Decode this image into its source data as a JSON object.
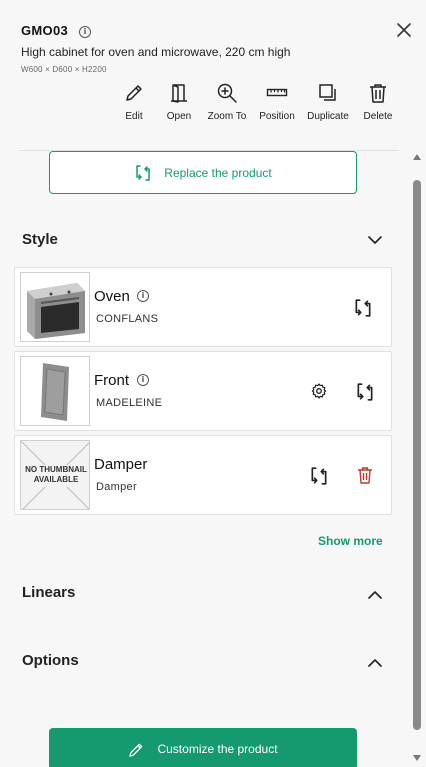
{
  "header": {
    "title": "GMO03",
    "subtitle": "High cabinet for oven and microwave, 220 cm high",
    "dimensions": "W600 × D600 × H2200"
  },
  "toolbar": {
    "items": [
      {
        "label": "Edit",
        "icon": "pencil-icon"
      },
      {
        "label": "Open",
        "icon": "door-open-icon"
      },
      {
        "label": "Zoom To",
        "icon": "zoom-in-icon"
      },
      {
        "label": "Position",
        "icon": "ruler-icon"
      },
      {
        "label": "Duplicate",
        "icon": "duplicate-icon"
      },
      {
        "label": "Delete",
        "icon": "trash-icon"
      }
    ]
  },
  "replace_button": {
    "label": "Replace the product",
    "icon": "replace-icon"
  },
  "sections": {
    "style": {
      "title": "Style",
      "expanded": true
    },
    "linears": {
      "title": "Linears",
      "expanded": false
    },
    "options": {
      "title": "Options",
      "expanded": false
    }
  },
  "style_items": [
    {
      "name": "Oven",
      "variant": "CONFLANS",
      "thumbnail": "oven-image"
    },
    {
      "name": "Front",
      "variant": "MADELEINE",
      "thumbnail": "front-panel-image"
    },
    {
      "name": "Damper",
      "variant": "Damper",
      "thumbnail_text": "NO THUMBNAIL AVAILABLE"
    }
  ],
  "show_more_label": "Show more",
  "customize_button": {
    "label": "Customize the product",
    "icon": "pencil-icon"
  },
  "colors": {
    "accent": "#159a70",
    "delete_red": "#c0392b",
    "background": "#f7f7f7"
  }
}
